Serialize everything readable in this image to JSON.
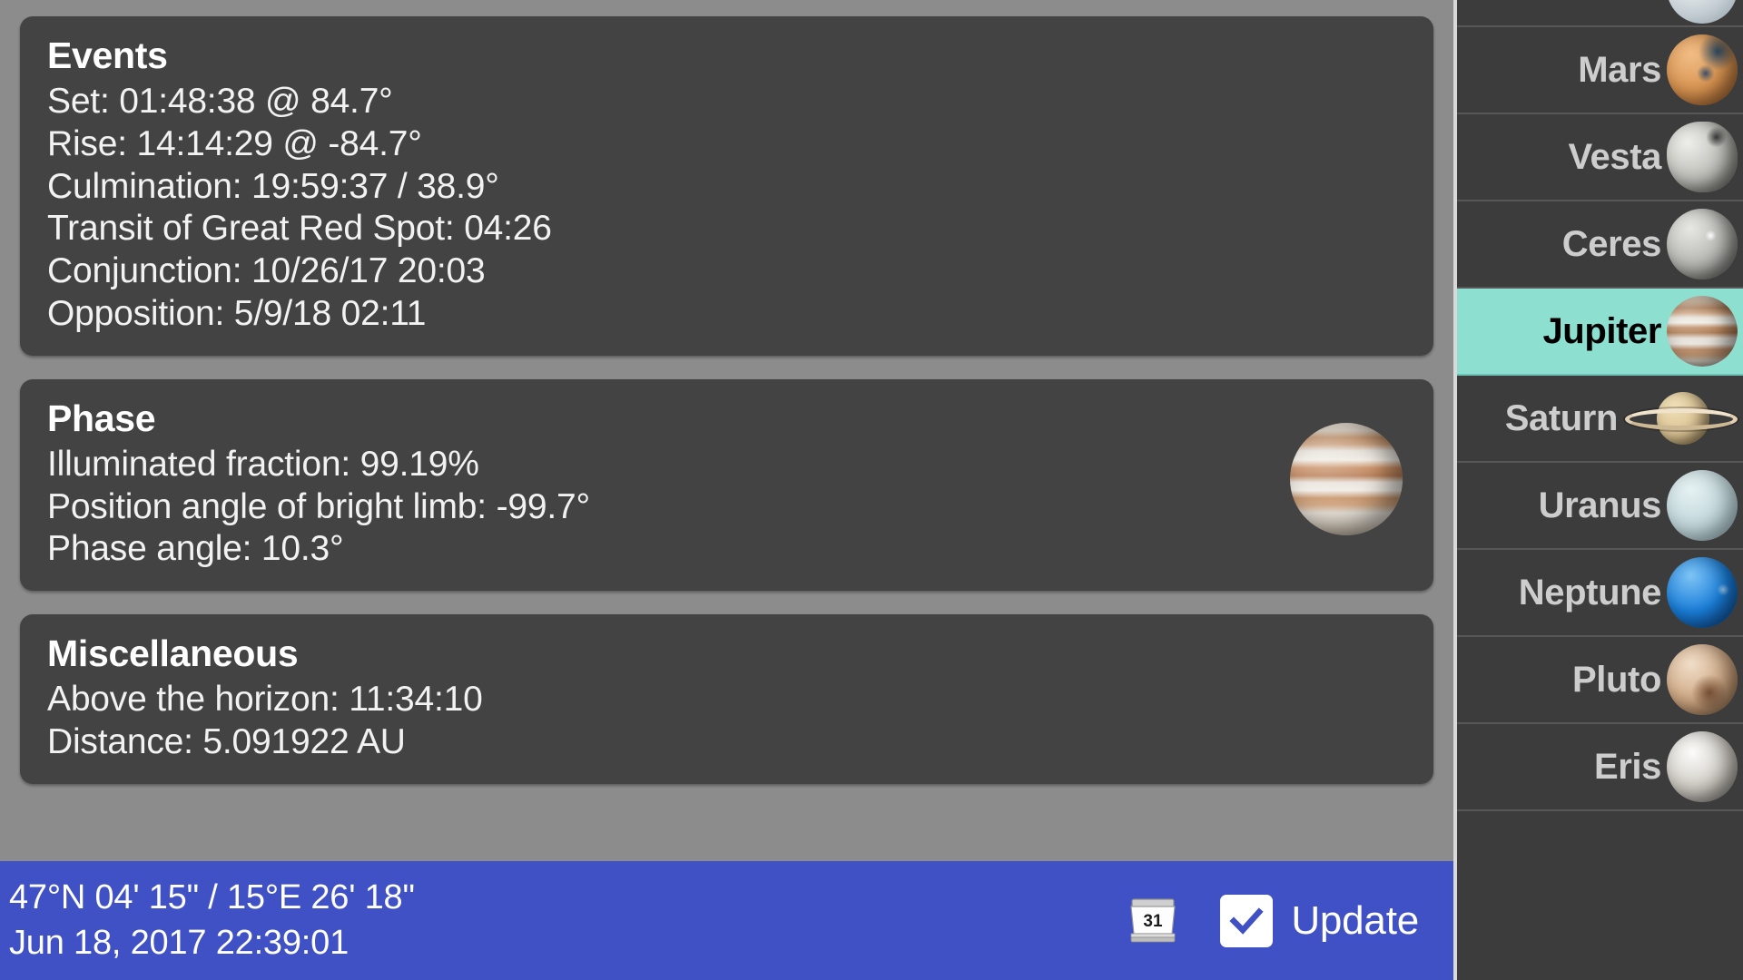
{
  "cards": [
    {
      "title": "Events",
      "lines": [
        "Set: 01:48:38 @ 84.7°",
        "Rise: 14:14:29 @ -84.7°",
        "Culmination: 19:59:37 / 38.9°",
        "Transit of Great Red Spot: 04:26",
        "Conjunction: 10/26/17 20:03",
        "Opposition: 5/9/18 02:11"
      ]
    },
    {
      "title": "Phase",
      "lines": [
        "Illuminated fraction: 99.19%",
        "Position angle of bright limb: -99.7°",
        "Phase angle: 10.3°"
      ]
    },
    {
      "title": "Miscellaneous",
      "lines": [
        "Above the horizon: 11:34:10",
        "Distance: 5.091922 AU"
      ]
    }
  ],
  "status_bar": {
    "coordinates": "47°N 04' 15\" / 15°E 26' 18\"",
    "datetime": "Jun 18, 2017 22:39:01",
    "calendar_day": "31",
    "update_label": "Update",
    "update_checked": true,
    "background_color": "#3f51c4"
  },
  "sidebar": {
    "selected": "Jupiter",
    "selected_color": "#8ddfd0",
    "items": [
      {
        "label": "",
        "thumb": "partial"
      },
      {
        "label": "Mars",
        "thumb": "mars"
      },
      {
        "label": "Vesta",
        "thumb": "vesta"
      },
      {
        "label": "Ceres",
        "thumb": "ceres"
      },
      {
        "label": "Jupiter",
        "thumb": "jupiter"
      },
      {
        "label": "Saturn",
        "thumb": "saturn"
      },
      {
        "label": "Uranus",
        "thumb": "uranus"
      },
      {
        "label": "Neptune",
        "thumb": "neptune"
      },
      {
        "label": "Pluto",
        "thumb": "pluto"
      },
      {
        "label": "Eris",
        "thumb": "eris"
      }
    ]
  }
}
